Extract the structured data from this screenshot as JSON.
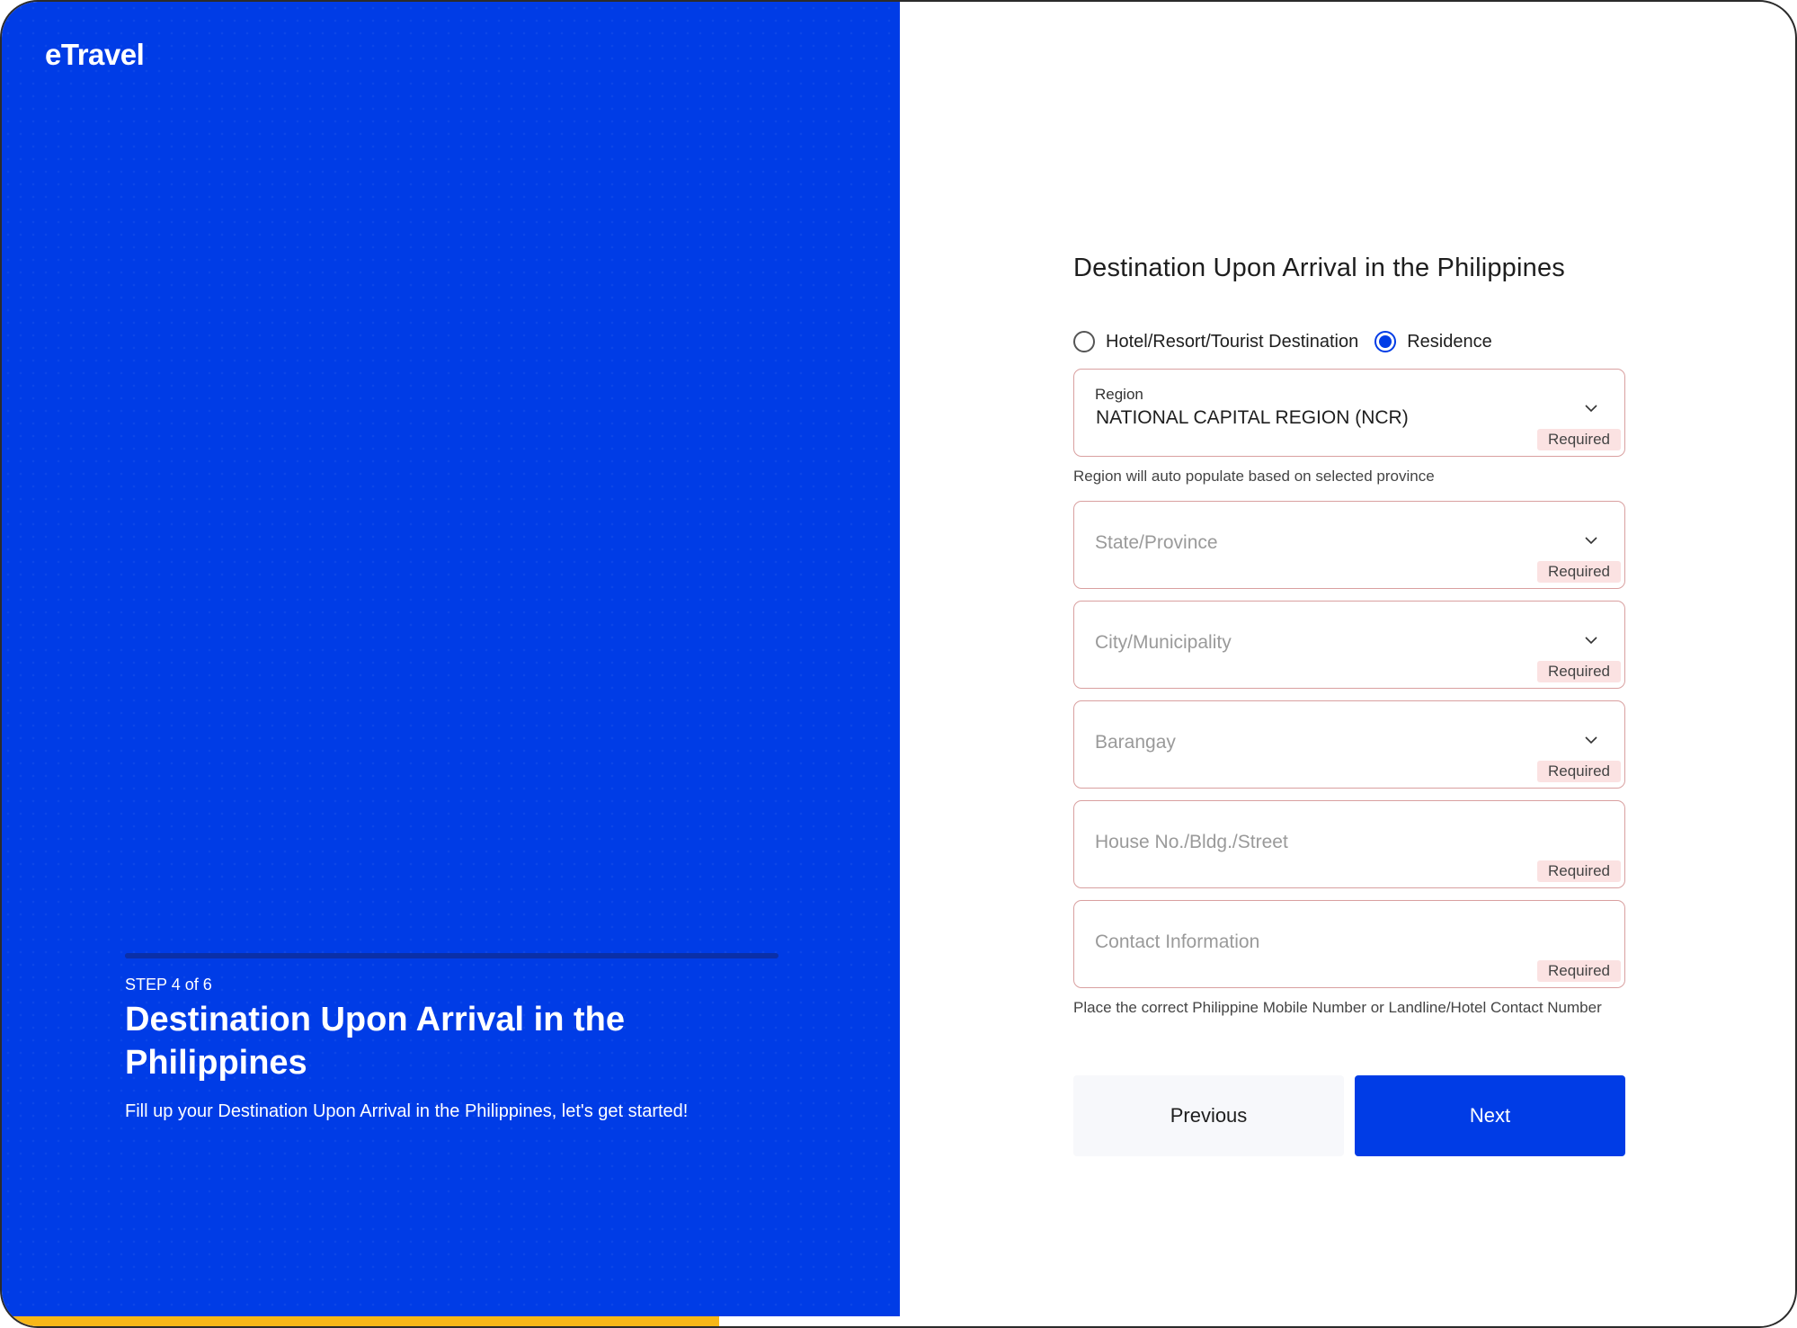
{
  "brand": {
    "logo": "eTravel"
  },
  "sidebar": {
    "step_label": "STEP 4 of 6",
    "step_progress": 0.667,
    "title": "Destination Upon Arrival in the Philippines",
    "subtitle": "Fill up your Destination Upon Arrival in the Philippines, let's get started!",
    "overall_progress": 0.4
  },
  "form": {
    "title": "Destination Upon Arrival in the Philippines",
    "destination_type": {
      "options": [
        {
          "label": "Hotel/Resort/Tourist Destination",
          "selected": false
        },
        {
          "label": "Residence",
          "selected": true
        }
      ]
    },
    "fields": {
      "region": {
        "label": "Region",
        "value": "NATIONAL CAPITAL REGION (NCR)",
        "badge": "Required"
      },
      "region_hint": "Region will auto populate based on selected province",
      "province": {
        "placeholder": "State/Province",
        "badge": "Required"
      },
      "city": {
        "placeholder": "City/Municipality",
        "badge": "Required"
      },
      "barangay": {
        "placeholder": "Barangay",
        "badge": "Required"
      },
      "street": {
        "placeholder": "House No./Bldg./Street",
        "badge": "Required"
      },
      "contact": {
        "placeholder": "Contact Information",
        "badge": "Required"
      },
      "contact_hint": "Place the correct Philippine Mobile Number or Landline/Hotel Contact Number"
    },
    "buttons": {
      "previous": "Previous",
      "next": "Next"
    }
  },
  "colors": {
    "brand_blue": "#003ce6",
    "accent_yellow": "#f7b718",
    "required_bg": "#fbe2e2",
    "field_border": "#d9a0a0"
  },
  "icons": {
    "dropdown": "chevron-down-icon"
  }
}
